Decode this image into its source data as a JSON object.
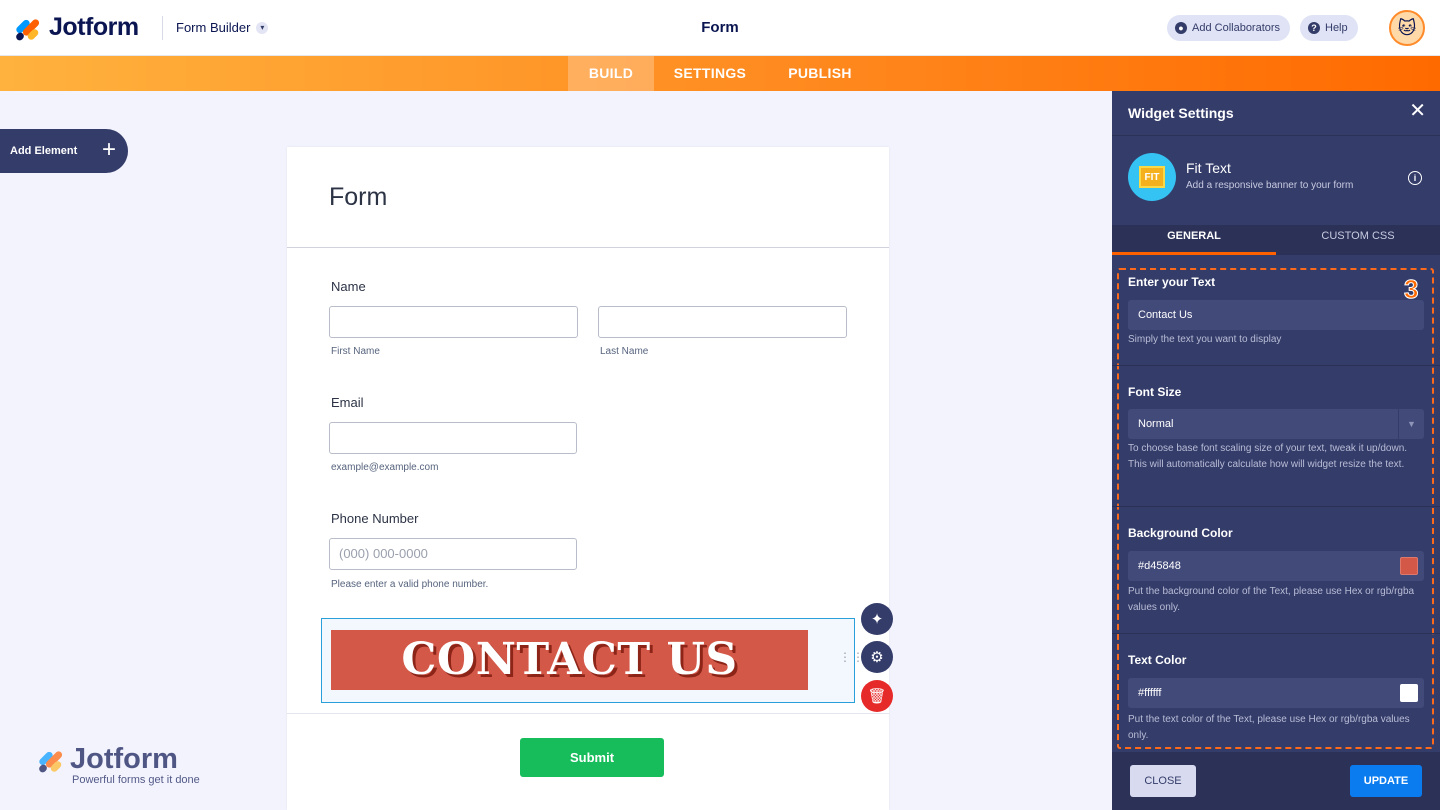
{
  "topbar": {
    "brand": "Jotform",
    "builder_menu": "Form Builder",
    "title": "Form",
    "add_collaborators": "Add Collaborators",
    "help": "Help"
  },
  "nav": {
    "tabs": [
      "BUILD",
      "SETTINGS",
      "PUBLISH"
    ],
    "active": "BUILD"
  },
  "add_element": {
    "label": "Add Element"
  },
  "form": {
    "title": "Form",
    "name_label": "Name",
    "first_name_sub": "First Name",
    "last_name_sub": "Last Name",
    "email_label": "Email",
    "email_sub": "example@example.com",
    "phone_label": "Phone Number",
    "phone_placeholder": "(000) 000-0000",
    "phone_sub": "Please enter a valid phone number.",
    "banner_text": "CONTACT US",
    "submit_label": "Submit"
  },
  "watermark": {
    "brand": "Jotform",
    "tagline": "Powerful forms get it done"
  },
  "panel": {
    "title": "Widget Settings",
    "widget_name": "Fit Text",
    "widget_desc": "Add a responsive banner to your form",
    "widget_icon_label": "FIT",
    "tabs": [
      "GENERAL",
      "CUSTOM CSS"
    ],
    "step_badge": "3",
    "fields": {
      "text": {
        "label": "Enter your Text",
        "value": "Contact Us",
        "help": "Simply the text you want to display"
      },
      "font_size": {
        "label": "Font Size",
        "value": "Normal",
        "help": "To choose base font scaling size of your text, tweak it up/down. This will automatically calculate how will widget resize the text."
      },
      "bg_color": {
        "label": "Background Color",
        "value": "#d45848",
        "help": "Put the background color of the Text, please use Hex or rgb/rgba values only."
      },
      "text_color": {
        "label": "Text Color",
        "value": "#ffffff",
        "help": "Put the text color of the Text, please use Hex or rgb/rgba values only."
      }
    },
    "close_label": "CLOSE",
    "update_label": "UPDATE"
  },
  "colors": {
    "brand_orange": "#ff6100",
    "panel_bg": "#343c6a",
    "banner_bg": "#d45848",
    "submit_green": "#18bd5b",
    "update_blue": "#0a7cf0"
  }
}
